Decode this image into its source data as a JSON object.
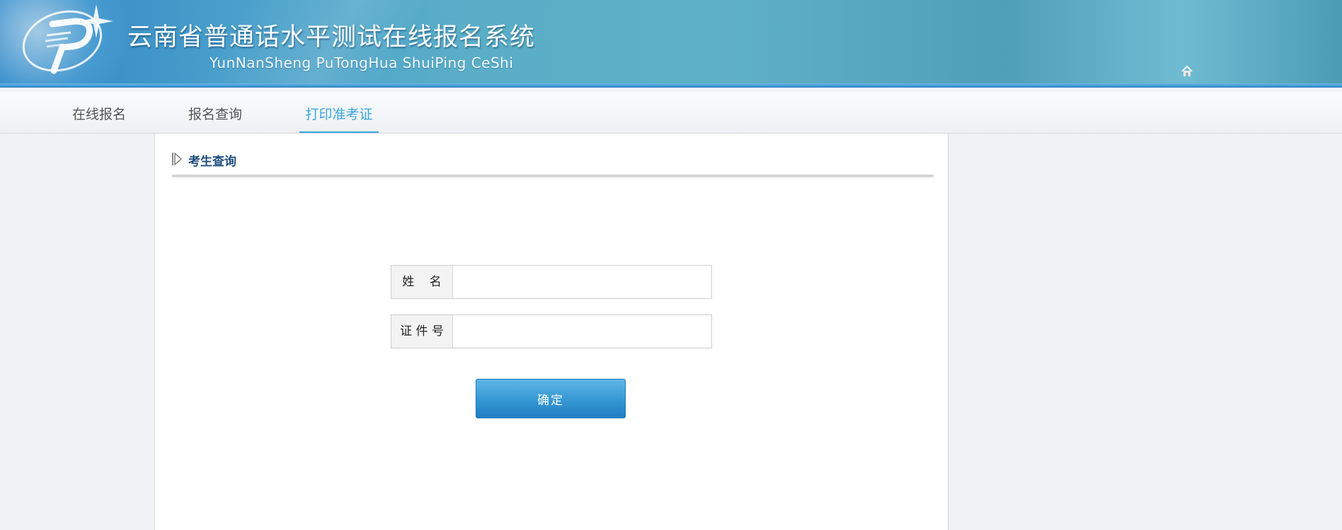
{
  "header": {
    "title": "云南省普通话水平测试在线报名系统",
    "subtitle": "YunNanSheng PuTongHua ShuiPing CeShi",
    "logo_icon": "putonghua-logo-icon",
    "home_icon": "home-icon"
  },
  "nav": {
    "items": [
      {
        "label": "在线报名",
        "active": false
      },
      {
        "label": "报名查询",
        "active": false
      },
      {
        "label": "打印准考证",
        "active": true
      }
    ],
    "active_color": "#3aa6de"
  },
  "section": {
    "title": "考生查询"
  },
  "form": {
    "name_label": "姓    名",
    "name_value": "",
    "id_label": "证 件 号",
    "id_value": "",
    "submit_label": "确定"
  },
  "colors": {
    "brand": "#2f86c4",
    "button": "#3597d3",
    "section_title": "#1f4f7d"
  }
}
